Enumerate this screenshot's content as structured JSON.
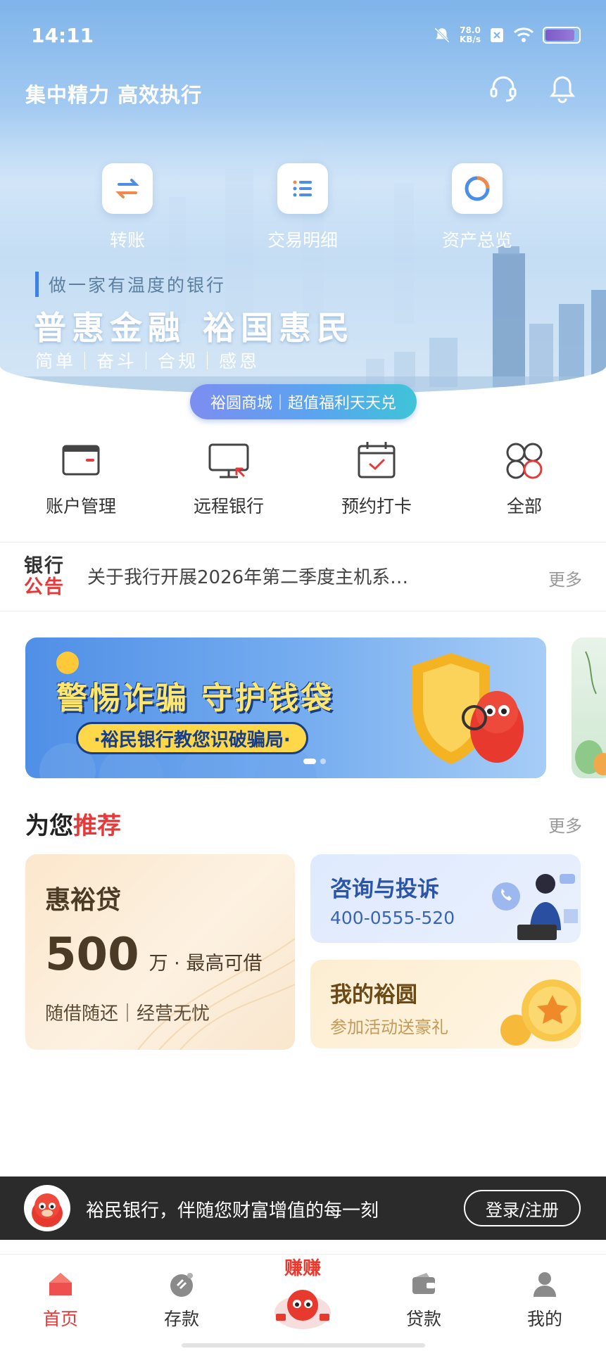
{
  "status_bar": {
    "time": "14:11",
    "net_speed_value": "78.0",
    "net_speed_unit": "KB/s",
    "battery_level": 0.9
  },
  "header": {
    "slogan": "集中精力 高效执行",
    "icons": [
      "headset-icon",
      "bell-icon"
    ]
  },
  "quick_actions": [
    {
      "label": "转账",
      "icon": "transfer-icon"
    },
    {
      "label": "交易明细",
      "icon": "list-icon"
    },
    {
      "label": "资产总览",
      "icon": "ring-chart-icon"
    }
  ],
  "hero": {
    "tagline": "做一家有温度的银行",
    "headline": "普惠金融 裕国惠民",
    "values": "简单｜奋斗｜合规｜感恩",
    "mall_pill": "裕圆商城｜超值福利天天兑"
  },
  "services": [
    {
      "label": "账户管理",
      "icon": "card-icon"
    },
    {
      "label": "远程银行",
      "icon": "monitor-icon"
    },
    {
      "label": "预约打卡",
      "icon": "calendar-check-icon"
    },
    {
      "label": "全部",
      "icon": "grid-icon"
    }
  ],
  "notice": {
    "logo_line1": "银行",
    "logo_line2": "公告",
    "text": "关于我行开展2026年第二季度主机系…",
    "more": "更多"
  },
  "banner": {
    "title": "警惕诈骗 守护钱袋",
    "subtitle": "·裕民银行教您识破骗局·",
    "active_index": 0,
    "total": 2
  },
  "recommend": {
    "title_part1": "为您",
    "title_part2": "推荐",
    "more": "更多",
    "loan": {
      "name": "惠裕贷",
      "amount": "500",
      "unit": "万 · 最高可借",
      "tagline": "随借随还｜经营无忧"
    },
    "consult": {
      "title": "咨询与投诉",
      "phone": "400-0555-520"
    },
    "yuyuan": {
      "title": "我的裕圆",
      "subtitle": "参加活动送豪礼"
    }
  },
  "login_bar": {
    "text": "裕民银行，伴随您财富增值的每一刻",
    "button": "登录/注册"
  },
  "tabbar": {
    "tabs": [
      {
        "label": "首页",
        "icon": "home-icon",
        "active": true
      },
      {
        "label": "存款",
        "icon": "deposit-icon",
        "active": false
      },
      {
        "label": "",
        "icon": "earn-mascot-icon",
        "active": false
      },
      {
        "label": "贷款",
        "icon": "wallet-icon",
        "active": false
      },
      {
        "label": "我的",
        "icon": "user-icon",
        "active": false
      }
    ],
    "center_badge_text": "赚赚"
  },
  "colors": {
    "brand_red": "#e63a3a",
    "hero_blue": "#7fb4ea",
    "login_bar_bg": "#2b2b2b"
  }
}
